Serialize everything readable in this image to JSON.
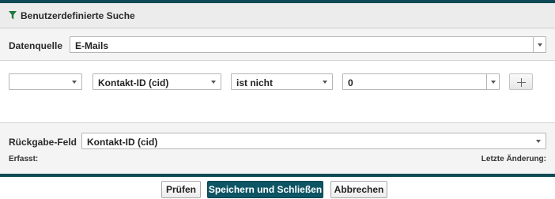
{
  "panel": {
    "title": "Benutzerdefinierte Suche",
    "icon": "filter-funnel-icon",
    "accent_color": "#0d4a55",
    "funnel_color": "#1b7a3c"
  },
  "source": {
    "label": "Datenquelle",
    "value": "E-Mails"
  },
  "criteria": {
    "conjunction": "",
    "field": "Kontakt-ID (cid)",
    "operator": "ist nicht",
    "value": "0"
  },
  "return_field": {
    "label": "Rückgabe-Feld",
    "value": "Kontakt-ID (cid)"
  },
  "meta": {
    "created_label": "Erfasst:",
    "modified_label": "Letzte Änderung:"
  },
  "buttons": {
    "check": "Prüfen",
    "save_close": "Speichern und Schließen",
    "cancel": "Abbrechen"
  }
}
